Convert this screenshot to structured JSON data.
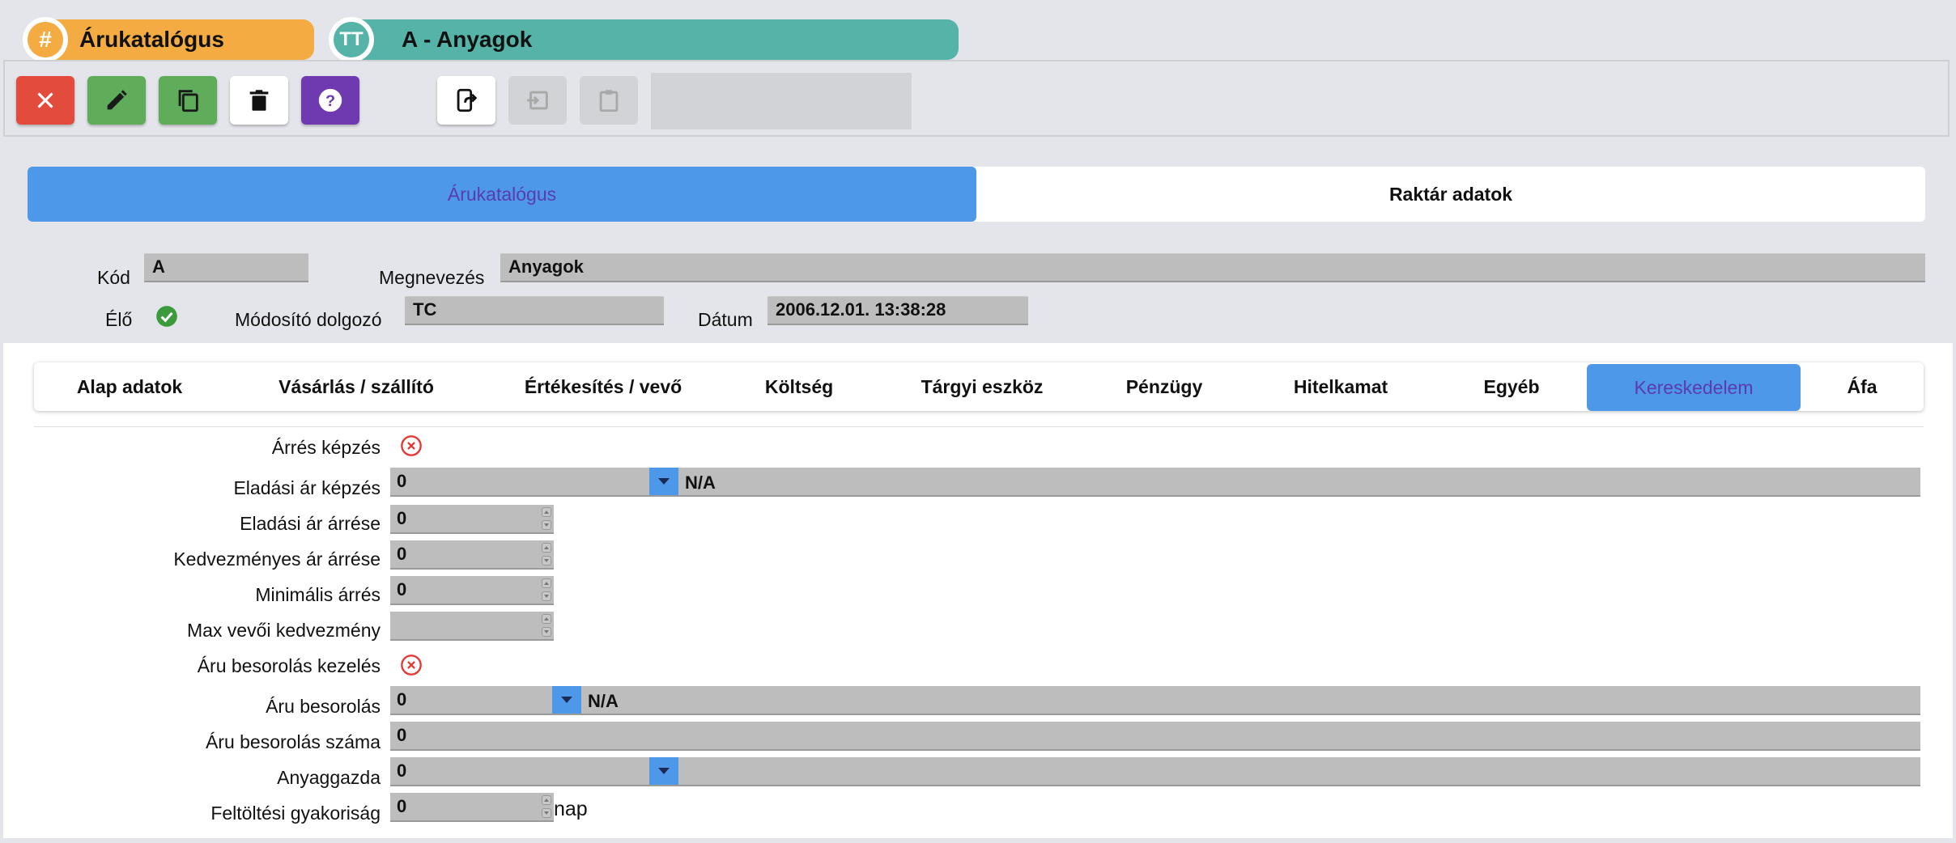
{
  "title_bar": {
    "catalog_title": "Árukatalógus",
    "catalog_icon": "hash-icon",
    "record_title": "A - Anyagok",
    "record_icon": "text-format-icon",
    "record_icon_glyph": "TT"
  },
  "toolbar": {
    "buttons": [
      {
        "name": "close",
        "icon": "close-icon",
        "color": "#e34b3c"
      },
      {
        "name": "edit",
        "icon": "pencil-icon",
        "color": "#5fac5a"
      },
      {
        "name": "copy",
        "icon": "copy-icon",
        "color": "#5fac5a"
      },
      {
        "name": "delete",
        "icon": "trash-icon",
        "color": "#ffffff"
      },
      {
        "name": "help",
        "icon": "help-icon",
        "color": "#6f3ab0"
      },
      {
        "name": "export",
        "icon": "export-icon",
        "color": "#ffffff"
      },
      {
        "name": "import",
        "icon": "import-icon",
        "color": "disabled"
      },
      {
        "name": "paste",
        "icon": "clipboard-icon",
        "color": "disabled"
      }
    ]
  },
  "main_tabs": [
    {
      "label": "Árukatalógus",
      "active": true
    },
    {
      "label": "Raktár adatok",
      "active": false
    }
  ],
  "header": {
    "code_label": "Kód",
    "code_value": "A",
    "name_label": "Megnevezés",
    "name_value": "Anyagok",
    "live_label": "Élő",
    "live_status": "check-circle-icon",
    "modifier_label": "Módosító dolgozó",
    "modifier_value": "TC",
    "date_label": "Dátum",
    "date_value": "2006.12.01. 13:38:28"
  },
  "sub_tabs": [
    {
      "label": "Alap adatok",
      "active": false
    },
    {
      "label": "Vásárlás / szállító",
      "active": false
    },
    {
      "label": "Értékesítés / vevő",
      "active": false
    },
    {
      "label": "Költség",
      "active": false
    },
    {
      "label": "Tárgyi eszköz",
      "active": false
    },
    {
      "label": "Pénzügy",
      "active": false
    },
    {
      "label": "Hitelkamat",
      "active": false
    },
    {
      "label": "Egyéb",
      "active": false
    },
    {
      "label": "Kereskedelem",
      "active": true
    },
    {
      "label": "Áfa",
      "active": false
    }
  ],
  "form": {
    "margin_label": "Árrés képzés",
    "sale_price_label": "Eladási ár képzés",
    "sale_price_value": "0",
    "sale_price_text": "N/A",
    "sale_margin_label": "Eladási ár árrése",
    "sale_margin_value": "0",
    "discount_margin_label": "Kedvezményes ár árrése",
    "discount_margin_value": "0",
    "min_margin_label": "Minimális árrés",
    "min_margin_value": "0",
    "max_discount_label": "Max vevői kedvezmény",
    "max_discount_value": "",
    "classification_mgmt_label": "Áru besorolás kezelés",
    "classification_label": "Áru besorolás",
    "classification_value": "0",
    "classification_text": "N/A",
    "classification_number_label": "Áru besorolás száma",
    "classification_number_value": "0",
    "material_owner_label": "Anyaggazda",
    "material_owner_value": "0",
    "refill_label": "Feltöltési gyakoriság",
    "refill_value": "0",
    "refill_unit": "nap"
  }
}
